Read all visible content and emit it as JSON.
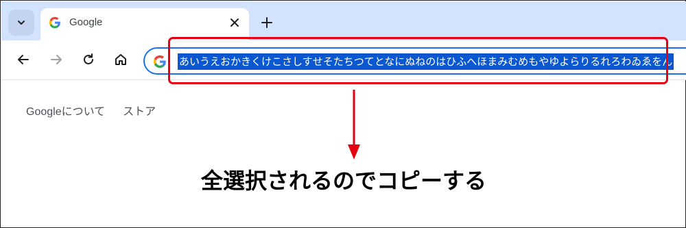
{
  "browser": {
    "tab": {
      "title": "Google"
    },
    "address_bar": {
      "text": "あいうえおかきくけこさしすせそたちつてとなにぬねのはひふへほまみむめもやゆよらりるれろわゐゑをん"
    }
  },
  "page": {
    "links": [
      "Googleについて",
      "ストア"
    ]
  },
  "annotation": {
    "caption": "全選択されるのでコピーする",
    "highlight_color": "#e60012",
    "selection_color": "#0b57d0"
  }
}
